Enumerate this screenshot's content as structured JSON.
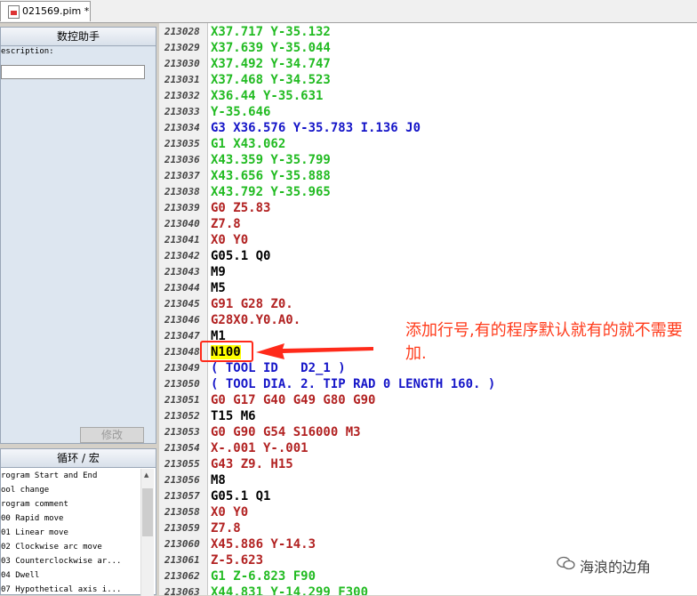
{
  "tab": {
    "title": "021569.pim *",
    "icon": "file-icon"
  },
  "assistant": {
    "title": "数控助手",
    "description_label": "escription:",
    "description_value": "",
    "modify_button": "修改"
  },
  "macros": {
    "title": "循环 / 宏",
    "items": [
      "rogram Start and End",
      "ool change",
      "rogram comment",
      "00 Rapid move",
      "01 Linear move",
      "02 Clockwise arc move",
      "03 Counterclockwise ar...",
      "04 Dwell",
      "07 Hypothetical axis i..."
    ]
  },
  "editor": {
    "lines": [
      {
        "num": "213028",
        "segs": [
          {
            "t": "X37.717 Y-35.132",
            "c": "green"
          }
        ]
      },
      {
        "num": "213029",
        "segs": [
          {
            "t": "X37.639 Y-35.044",
            "c": "green"
          }
        ]
      },
      {
        "num": "213030",
        "segs": [
          {
            "t": "X37.492 Y-34.747",
            "c": "green"
          }
        ]
      },
      {
        "num": "213031",
        "segs": [
          {
            "t": "X37.468 Y-34.523",
            "c": "green"
          }
        ]
      },
      {
        "num": "213032",
        "segs": [
          {
            "t": "X36.44 Y-35.631",
            "c": "green"
          }
        ]
      },
      {
        "num": "213033",
        "segs": [
          {
            "t": "Y-35.646",
            "c": "green"
          }
        ]
      },
      {
        "num": "213034",
        "segs": [
          {
            "t": "G3 X36.576 Y-35.783 I.136 J0",
            "c": "blue"
          }
        ]
      },
      {
        "num": "213035",
        "segs": [
          {
            "t": "G1 X43.062",
            "c": "green"
          }
        ]
      },
      {
        "num": "213036",
        "segs": [
          {
            "t": "X43.359 Y-35.799",
            "c": "green"
          }
        ]
      },
      {
        "num": "213037",
        "segs": [
          {
            "t": "X43.656 Y-35.888",
            "c": "green"
          }
        ]
      },
      {
        "num": "213038",
        "segs": [
          {
            "t": "X43.792 Y-35.965",
            "c": "green"
          }
        ]
      },
      {
        "num": "213039",
        "segs": [
          {
            "t": "G0 Z5.83",
            "c": "red"
          }
        ]
      },
      {
        "num": "213040",
        "segs": [
          {
            "t": "Z7.8",
            "c": "red"
          }
        ]
      },
      {
        "num": "213041",
        "segs": [
          {
            "t": "X0 Y0",
            "c": "red"
          }
        ]
      },
      {
        "num": "213042",
        "segs": [
          {
            "t": "G05.1 Q0",
            "c": "black"
          }
        ]
      },
      {
        "num": "213043",
        "segs": [
          {
            "t": "M9",
            "c": "black"
          }
        ]
      },
      {
        "num": "213044",
        "segs": [
          {
            "t": "M5",
            "c": "black"
          }
        ]
      },
      {
        "num": "213045",
        "segs": [
          {
            "t": "G91 G28 Z0.",
            "c": "red"
          }
        ]
      },
      {
        "num": "213046",
        "segs": [
          {
            "t": "G28X0.Y0.A0.",
            "c": "red"
          }
        ]
      },
      {
        "num": "213047",
        "segs": [
          {
            "t": "M1",
            "c": "black"
          }
        ]
      },
      {
        "num": "213048",
        "segs": [
          {
            "t": "N100",
            "c": "black",
            "hl": true
          }
        ]
      },
      {
        "num": "213049",
        "segs": [
          {
            "t": "( TOOL ID   D2_1 )",
            "c": "blue"
          }
        ]
      },
      {
        "num": "213050",
        "segs": [
          {
            "t": "( TOOL DIA. 2. TIP RAD 0 LENGTH 160. )",
            "c": "blue"
          }
        ]
      },
      {
        "num": "213051",
        "segs": [
          {
            "t": "G0 G17 G40 G49 G80 G90",
            "c": "red"
          }
        ]
      },
      {
        "num": "213052",
        "segs": [
          {
            "t": "T15 M6",
            "c": "black"
          }
        ]
      },
      {
        "num": "213053",
        "segs": [
          {
            "t": "G0 G90 G54 S16000 M3",
            "c": "red"
          }
        ]
      },
      {
        "num": "213054",
        "segs": [
          {
            "t": "X-.001 Y-.001",
            "c": "red"
          }
        ]
      },
      {
        "num": "213055",
        "segs": [
          {
            "t": "G43 Z9. H15",
            "c": "red"
          }
        ]
      },
      {
        "num": "213056",
        "segs": [
          {
            "t": "M8",
            "c": "black"
          }
        ]
      },
      {
        "num": "213057",
        "segs": [
          {
            "t": "G05.1 Q1",
            "c": "black"
          }
        ]
      },
      {
        "num": "213058",
        "segs": [
          {
            "t": "X0 Y0",
            "c": "red"
          }
        ]
      },
      {
        "num": "213059",
        "segs": [
          {
            "t": "Z7.8",
            "c": "red"
          }
        ]
      },
      {
        "num": "213060",
        "segs": [
          {
            "t": "X45.886 Y-14.3",
            "c": "red"
          }
        ]
      },
      {
        "num": "213061",
        "segs": [
          {
            "t": "Z-5.623",
            "c": "red"
          }
        ]
      },
      {
        "num": "213062",
        "segs": [
          {
            "t": "G1 Z-6.823 F90",
            "c": "green"
          }
        ]
      },
      {
        "num": "213063",
        "segs": [
          {
            "t": "X44.831 Y-14.299 F300",
            "c": "green"
          }
        ]
      }
    ]
  },
  "annotation": {
    "text": "添加行号,有的程序默认就有的就不需要加.",
    "color": "#ff3a1a"
  },
  "watermark": {
    "text": "海浪的边角",
    "icon": "wechat-icon"
  }
}
